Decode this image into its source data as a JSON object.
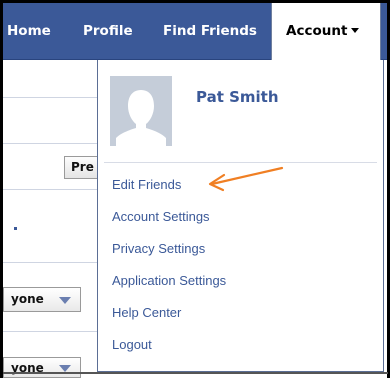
{
  "nav": {
    "home": "Home",
    "profile": "Profile",
    "find_friends": "Find Friends",
    "account": "Account"
  },
  "page": {
    "prev_button": "Pre",
    "privacy_select_1": "yone",
    "privacy_select_2": "yone"
  },
  "account_menu": {
    "user_name": "Pat Smith",
    "items": [
      {
        "label": "Edit Friends"
      },
      {
        "label": "Account Settings"
      },
      {
        "label": "Privacy Settings"
      },
      {
        "label": "Application Settings"
      },
      {
        "label": "Help Center"
      },
      {
        "label": "Logout"
      }
    ]
  },
  "colors": {
    "nav_blue": "#3b5998",
    "link_blue": "#3b5998",
    "annotation_orange": "#f07f23"
  },
  "icons": {
    "account_caret": "caret-down-icon",
    "select_caret": "triangle-down-icon",
    "avatar": "silhouette-avatar",
    "annotation": "orange-arrow-icon"
  }
}
